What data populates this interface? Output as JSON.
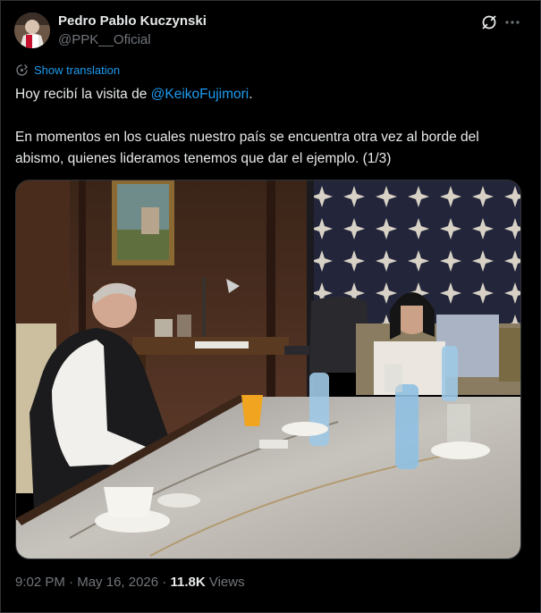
{
  "author": {
    "name": "Pedro Pablo Kuczynski",
    "handle": "@PPK__Oficial"
  },
  "icons": {
    "grok": "grok-icon",
    "more": "more-dots-icon",
    "translate": "translate-icon"
  },
  "translation": {
    "label": "Show translation"
  },
  "tweet": {
    "line1_prefix": "Hoy recibí la visita de ",
    "mention": "@KeikoFujimori",
    "line1_suffix": ".",
    "paragraph2": "En momentos en los cuales nuestro país se encuentra otra vez al borde del abismo, quienes lideramos tenemos que dar el ejemplo. (1/3)"
  },
  "meta": {
    "time": "9:02 PM",
    "separator": " · ",
    "date": "May 16, 2026",
    "views_count": "11.8K",
    "views_label": " Views"
  },
  "colors": {
    "background": "#000000",
    "text": "#e7e9ea",
    "secondary": "#71767b",
    "accent": "#1d9bf0",
    "border": "#2f3336"
  }
}
